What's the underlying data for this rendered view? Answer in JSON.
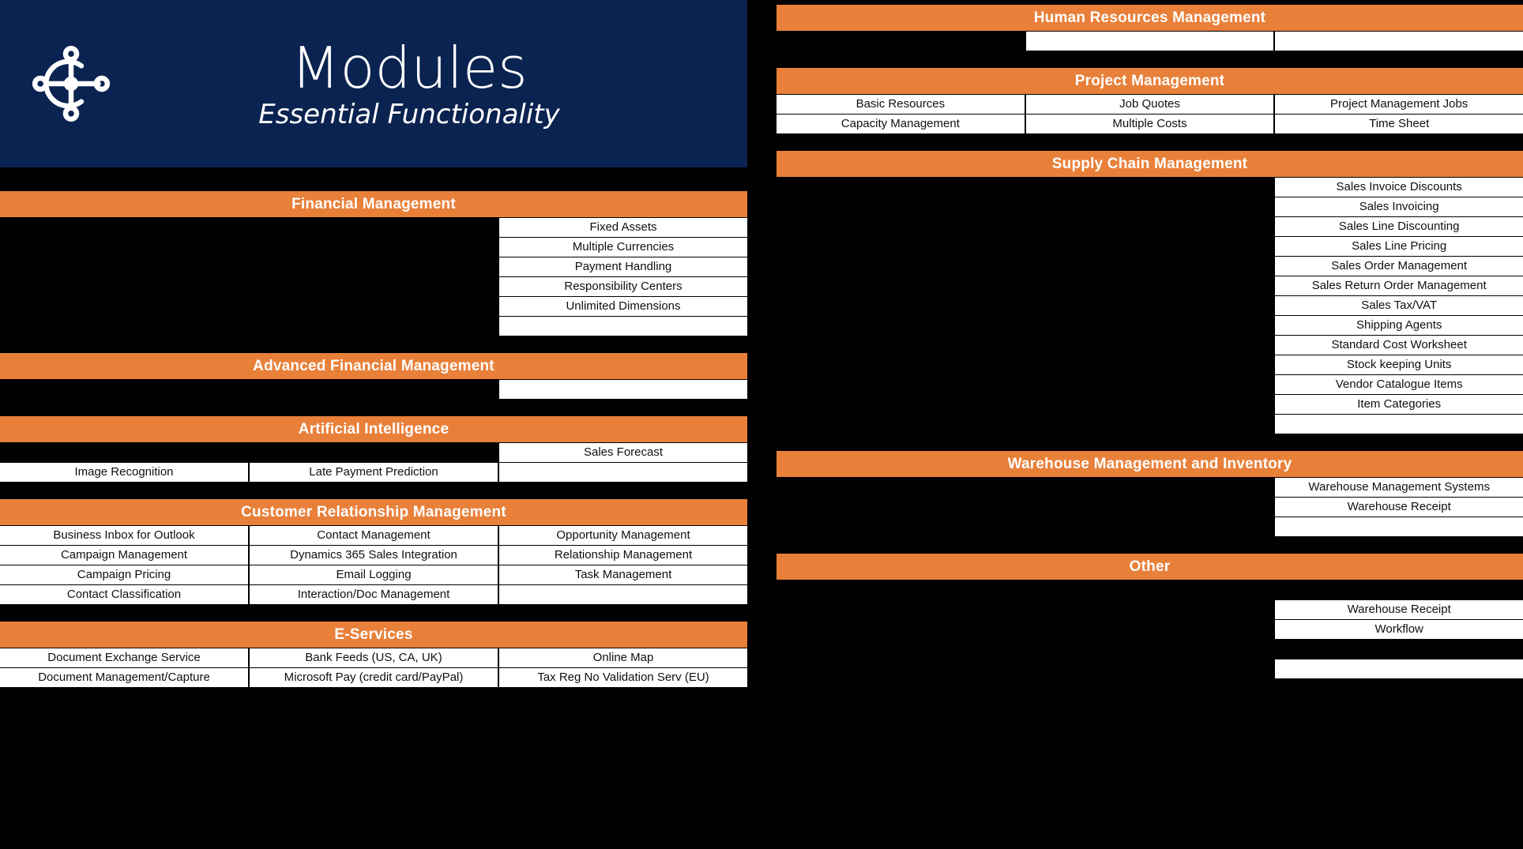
{
  "banner": {
    "icon": "hub-network-icon",
    "title": "Modules",
    "subtitle": "Essential Functionality",
    "bg_color": "#0b2350"
  },
  "theme": {
    "header_color": "#e8803a",
    "header_text_color": "#ffffff",
    "cell_bg": "#ffffff",
    "page_bg": "#000000"
  },
  "left_column": {
    "sections": [
      {
        "title": "Financial Management",
        "rows": [
          [
            "",
            "",
            "Fixed Assets"
          ],
          [
            "",
            "",
            "Multiple Currencies"
          ],
          [
            "",
            "",
            "Payment Handling"
          ],
          [
            "",
            "",
            "Responsibility Centers"
          ],
          [
            "",
            "",
            "Unlimited Dimensions"
          ],
          [
            "",
            "",
            ""
          ]
        ],
        "filled": [
          [
            false,
            false,
            true
          ],
          [
            false,
            false,
            true
          ],
          [
            false,
            false,
            true
          ],
          [
            false,
            false,
            true
          ],
          [
            false,
            false,
            true
          ],
          [
            false,
            false,
            true
          ]
        ]
      },
      {
        "title": "Advanced Financial Management",
        "rows": [
          [
            "",
            "",
            ""
          ]
        ],
        "filled": [
          [
            false,
            false,
            true
          ]
        ]
      },
      {
        "title": "Artificial Intelligence",
        "rows": [
          [
            "",
            "",
            "Sales Forecast"
          ],
          [
            "Image Recognition",
            "Late Payment Prediction",
            ""
          ]
        ],
        "filled": [
          [
            false,
            false,
            true
          ],
          [
            true,
            true,
            true
          ]
        ]
      },
      {
        "title": "Customer Relationship Management",
        "rows": [
          [
            "Business Inbox for Outlook",
            "Contact Management",
            "Opportunity Management"
          ],
          [
            "Campaign Management",
            "Dynamics 365 Sales Integration",
            "Relationship Management"
          ],
          [
            "Campaign Pricing",
            "Email Logging",
            "Task Management"
          ],
          [
            "Contact Classification",
            "Interaction/Doc Management",
            ""
          ]
        ],
        "filled": [
          [
            true,
            true,
            true
          ],
          [
            true,
            true,
            true
          ],
          [
            true,
            true,
            true
          ],
          [
            true,
            true,
            true
          ]
        ]
      },
      {
        "title": "E-Services",
        "rows": [
          [
            "Document Exchange Service",
            "Bank Feeds (US, CA, UK)",
            "Online Map"
          ],
          [
            "Document Management/Capture",
            "Microsoft Pay (credit card/PayPal)",
            "Tax Reg No Validation Serv (EU)"
          ]
        ],
        "filled": [
          [
            true,
            true,
            true
          ],
          [
            true,
            true,
            true
          ]
        ]
      }
    ]
  },
  "right_column": {
    "sections": [
      {
        "title": "Human Resources Management",
        "rows": [
          [
            "",
            "",
            ""
          ]
        ],
        "filled": [
          [
            false,
            true,
            true
          ]
        ]
      },
      {
        "title": "Project Management",
        "rows": [
          [
            "Basic Resources",
            "Job Quotes",
            "Project Management Jobs"
          ],
          [
            "Capacity Management",
            "Multiple Costs",
            "Time Sheet"
          ]
        ],
        "filled": [
          [
            true,
            true,
            true
          ],
          [
            true,
            true,
            true
          ]
        ]
      },
      {
        "title": "Supply Chain Management",
        "rows": [
          [
            "",
            "",
            "Sales Invoice Discounts"
          ],
          [
            "",
            "",
            "Sales Invoicing"
          ],
          [
            "",
            "",
            "Sales Line Discounting"
          ],
          [
            "",
            "",
            "Sales Line Pricing"
          ],
          [
            "",
            "",
            "Sales Order Management"
          ],
          [
            "",
            "",
            "Sales Return Order Management"
          ],
          [
            "",
            "",
            "Sales Tax/VAT"
          ],
          [
            "",
            "",
            "Shipping Agents"
          ],
          [
            "",
            "",
            "Standard Cost Worksheet"
          ],
          [
            "",
            "",
            "Stock keeping Units"
          ],
          [
            "",
            "",
            "Vendor Catalogue Items"
          ],
          [
            "",
            "",
            "Item Categories"
          ],
          [
            "",
            "",
            ""
          ]
        ],
        "filled": [
          [
            false,
            false,
            true
          ],
          [
            false,
            false,
            true
          ],
          [
            false,
            false,
            true
          ],
          [
            false,
            false,
            true
          ],
          [
            false,
            false,
            true
          ],
          [
            false,
            false,
            true
          ],
          [
            false,
            false,
            true
          ],
          [
            false,
            false,
            true
          ],
          [
            false,
            false,
            true
          ],
          [
            false,
            false,
            true
          ],
          [
            false,
            false,
            true
          ],
          [
            false,
            false,
            true
          ],
          [
            false,
            false,
            true
          ]
        ]
      },
      {
        "title": "Warehouse Management and Inventory",
        "rows": [
          [
            "",
            "",
            "Warehouse Management Systems"
          ],
          [
            "",
            "",
            "Warehouse Receipt"
          ],
          [
            "",
            "",
            ""
          ]
        ],
        "filled": [
          [
            false,
            false,
            true
          ],
          [
            false,
            false,
            true
          ],
          [
            false,
            false,
            true
          ]
        ]
      },
      {
        "title": "Other",
        "rows": [
          [
            "",
            "",
            ""
          ],
          [
            "",
            "",
            "Warehouse Receipt"
          ],
          [
            "",
            "",
            "Workflow"
          ],
          [
            "",
            "",
            ""
          ],
          [
            "",
            "",
            ""
          ]
        ],
        "filled": [
          [
            false,
            false,
            false
          ],
          [
            false,
            false,
            true
          ],
          [
            false,
            false,
            true
          ],
          [
            false,
            false,
            false
          ],
          [
            false,
            false,
            true
          ]
        ]
      }
    ]
  }
}
